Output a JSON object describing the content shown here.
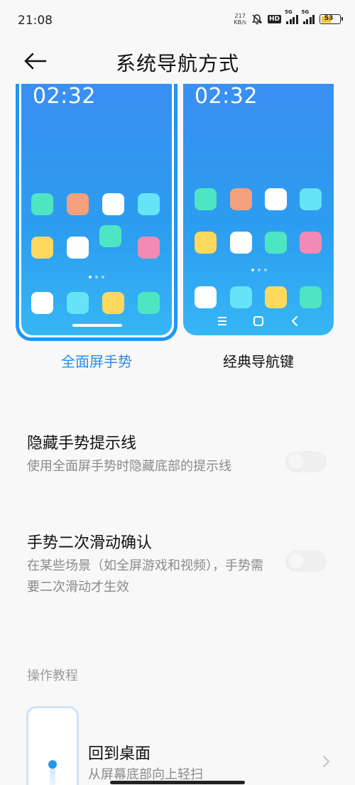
{
  "status_bar": {
    "time": "21:08",
    "net_speed_value": "217",
    "net_speed_unit": "KB/s",
    "hd_label": "HD",
    "sim1_label": "5G",
    "sim2_label": "5G",
    "battery_level": "53"
  },
  "header": {
    "title": "系统导航方式"
  },
  "previews": {
    "gesture": {
      "clock": "02:32",
      "label": "全面屏手势",
      "selected": true
    },
    "classic": {
      "clock": "02:32",
      "label": "经典导航键",
      "selected": false
    }
  },
  "settings": [
    {
      "title": "隐藏手势提示线",
      "description": "使用全面屏手势时隐藏底部的提示线",
      "enabled": false
    },
    {
      "title": "手势二次滑动确认",
      "description": "在某些场景（如全屏游戏和视频），手势需要二次滑动才生效",
      "enabled": false
    }
  ],
  "tutorial_section": {
    "header": "操作教程",
    "items": [
      {
        "title": "回到桌面",
        "description": "从屏幕底部向上轻扫"
      }
    ]
  },
  "colors": {
    "accent": "#2196f3",
    "accent_text": "#2a8be6",
    "app_green": "#4ee6c2",
    "app_orange": "#f4a07c",
    "app_white": "#ffffff",
    "app_cyan": "#66e3f6",
    "app_yellow": "#ffd85e",
    "app_pink": "#f28ab3"
  }
}
